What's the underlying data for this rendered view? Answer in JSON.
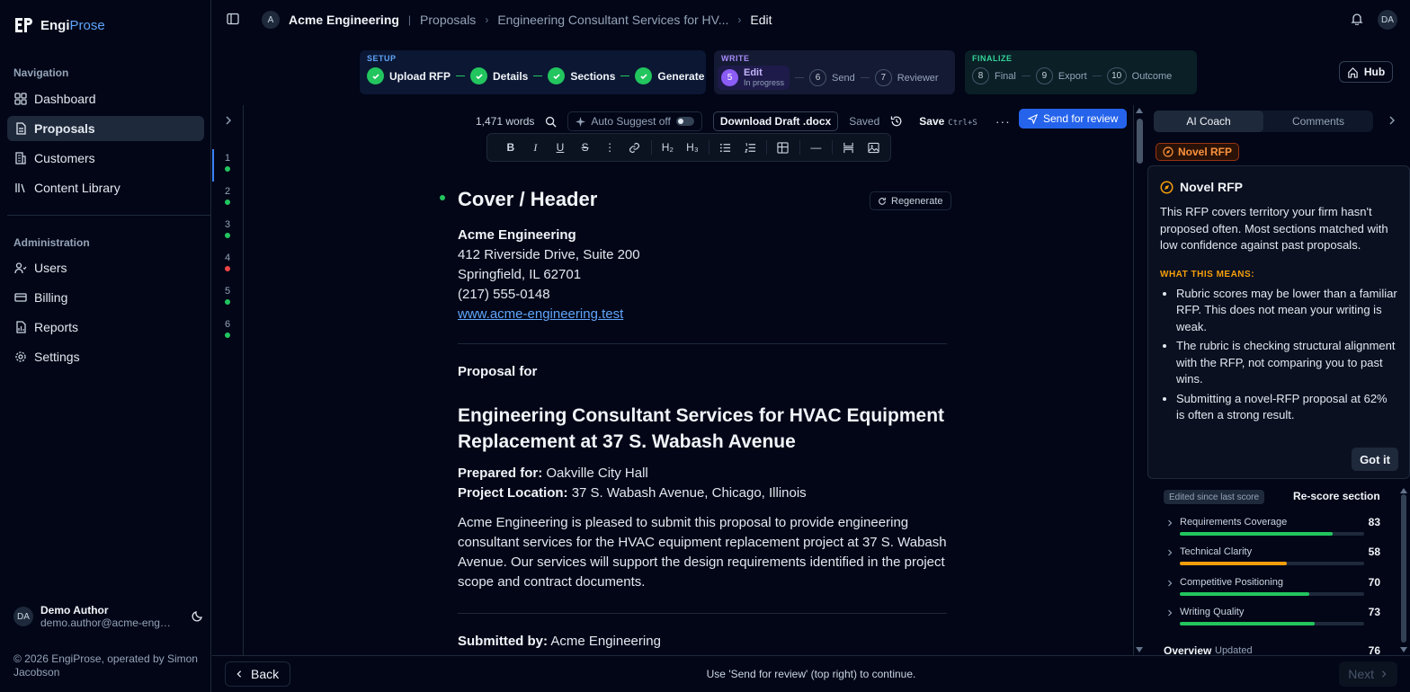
{
  "brand": {
    "name_part1": "Engi",
    "name_part2": "Prose"
  },
  "sidebar": {
    "navigation_heading": "Navigation",
    "nav_items": [
      {
        "label": "Dashboard",
        "icon": "dashboard-icon"
      },
      {
        "label": "Proposals",
        "icon": "document-icon",
        "active": true
      },
      {
        "label": "Customers",
        "icon": "building-icon"
      },
      {
        "label": "Content Library",
        "icon": "library-icon"
      }
    ],
    "admin_heading": "Administration",
    "admin_items": [
      {
        "label": "Users",
        "icon": "users-icon"
      },
      {
        "label": "Billing",
        "icon": "credit-card-icon"
      },
      {
        "label": "Reports",
        "icon": "chart-icon"
      },
      {
        "label": "Settings",
        "icon": "gear-icon"
      }
    ],
    "user": {
      "initials": "DA",
      "name": "Demo Author",
      "email": "demo.author@acme-engineering.test"
    },
    "copyright": "© 2026 EngiProse, operated by Simon Jacobson"
  },
  "topbar": {
    "org_initial": "A",
    "org_name": "Acme Engineering",
    "crumb_proposals": "Proposals",
    "crumb_proposal": "Engineering Consultant Services for HV...",
    "crumb_current": "Edit",
    "user_initials": "DA"
  },
  "stepper": {
    "setup": {
      "label": "SETUP",
      "steps": [
        "Upload RFP",
        "Details",
        "Sections",
        "Generate"
      ]
    },
    "write": {
      "label": "WRITE",
      "active_num": "5",
      "active_label": "Edit",
      "active_status": "In progress",
      "steps": [
        {
          "num": "6",
          "label": "Send"
        },
        {
          "num": "7",
          "label": "Reviewer"
        }
      ]
    },
    "finalize": {
      "label": "FINALIZE",
      "steps": [
        {
          "num": "8",
          "label": "Final"
        },
        {
          "num": "9",
          "label": "Export"
        },
        {
          "num": "10",
          "label": "Outcome"
        }
      ]
    },
    "hub_label": "Hub"
  },
  "rail": {
    "sections": [
      {
        "num": "1",
        "status": "#22c55e"
      },
      {
        "num": "2",
        "status": "#22c55e"
      },
      {
        "num": "3",
        "status": "#22c55e"
      },
      {
        "num": "4",
        "status": "#ef4444"
      },
      {
        "num": "5",
        "status": "#22c55e"
      },
      {
        "num": "6",
        "status": "#22c55e"
      }
    ]
  },
  "editor": {
    "word_count": "1,471 words",
    "auto_suggest": "Auto Suggest off",
    "download": "Download Draft .docx",
    "saved": "Saved",
    "save": "Save",
    "save_shortcut": "Ctrl+S",
    "send_review": "Send for review",
    "format_tools": [
      "B",
      "I",
      "U",
      "S",
      "⋮",
      "link",
      "H₂",
      "H₃",
      "bullets",
      "numbers",
      "table",
      "—",
      "break",
      "image"
    ]
  },
  "doc": {
    "section_title": "Cover / Header",
    "regenerate": "Regenerate",
    "company": "Acme Engineering",
    "address1": "412 Riverside Drive, Suite 200",
    "address2": "Springfield, IL 62701",
    "phone": "(217) 555-0148",
    "website": "www.acme-engineering.test",
    "proposal_for": "Proposal for",
    "proposal_title": "Engineering Consultant Services for HVAC Equipment Replacement at 37 S. Wabash Avenue",
    "prepared_for_label": "Prepared for:",
    "prepared_for": "Oakville City Hall",
    "location_label": "Project Location:",
    "location": "37 S. Wabash Avenue, Chicago, Illinois",
    "intro": "Acme Engineering is pleased to submit this proposal to provide engineering consultant services for the HVAC equipment replacement project at 37 S. Wabash Avenue. Our services will support the design requirements identified in the project scope and contract documents.",
    "submitted_label": "Submitted by:",
    "submitted_by": "Acme Engineering"
  },
  "rpanel": {
    "tab_coach": "AI Coach",
    "tab_comments": "Comments",
    "badge": "Novel RFP",
    "popover": {
      "title": "Novel RFP",
      "body": "This RFP covers territory your firm hasn't proposed often. Most sections matched with low confidence against past proposals.",
      "heading": "WHAT THIS MEANS:",
      "bullets": [
        "Rubric scores may be lower than a familiar RFP. This does not mean your writing is weak.",
        "The rubric is checking structural alignment with the RFP, not comparing you to past wins.",
        "Submitting a novel-RFP proposal at 62% is often a strong result."
      ],
      "got_it": "Got it"
    },
    "edited_badge": "Edited since last score",
    "rescore": "Re-score section",
    "metrics": [
      {
        "label": "Requirements Coverage",
        "value": 83,
        "color": "#22c55e"
      },
      {
        "label": "Technical Clarity",
        "value": 58,
        "color": "#f59e0b"
      },
      {
        "label": "Competitive Positioning",
        "value": 70,
        "color": "#22c55e"
      },
      {
        "label": "Writing Quality",
        "value": 73,
        "color": "#22c55e"
      }
    ],
    "overview_title": "Overview",
    "overview_updated": "Updated",
    "overview_value": "76"
  },
  "footer": {
    "back": "Back",
    "hint": "Use 'Send for review' (top right) to continue.",
    "next": "Next"
  }
}
